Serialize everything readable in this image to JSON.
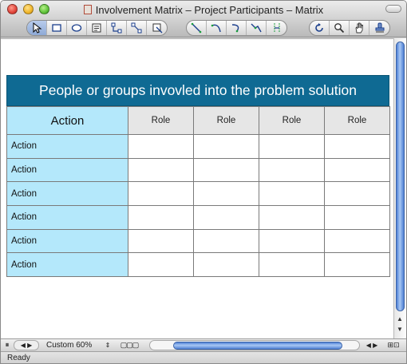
{
  "window": {
    "title": "Involvement Matrix – Project Participants  –  Matrix"
  },
  "toolbar": {
    "groups": [
      [
        "select-arrow-icon",
        "rectangle-icon",
        "ellipse-icon",
        "text-block-icon",
        "connector-icon",
        "line-connector-icon",
        "crop-icon"
      ],
      [
        "straight-line-icon",
        "arc-icon",
        "curve-icon",
        "polyline-icon",
        "bezier-icon"
      ],
      [
        "rotate-icon",
        "zoom-icon",
        "hand-pan-icon",
        "stamp-icon"
      ]
    ]
  },
  "matrix": {
    "title": "People or groups invovled into the problem solution",
    "corner_label": "Action",
    "role_headers": [
      "Role",
      "Role",
      "Role",
      "Role"
    ],
    "rows": [
      {
        "label": "Action"
      },
      {
        "label": "Action"
      },
      {
        "label": "Action"
      },
      {
        "label": "Action"
      },
      {
        "label": "Action"
      },
      {
        "label": "Action"
      }
    ]
  },
  "bottombar": {
    "zoom": "Custom 60%"
  },
  "status": {
    "text": "Ready"
  },
  "colors": {
    "header_bg": "#0f6a93",
    "action_cell_bg": "#b4e8fb",
    "role_cell_bg": "#e6e6e6",
    "scroll_thumb": "#6b9be3"
  }
}
